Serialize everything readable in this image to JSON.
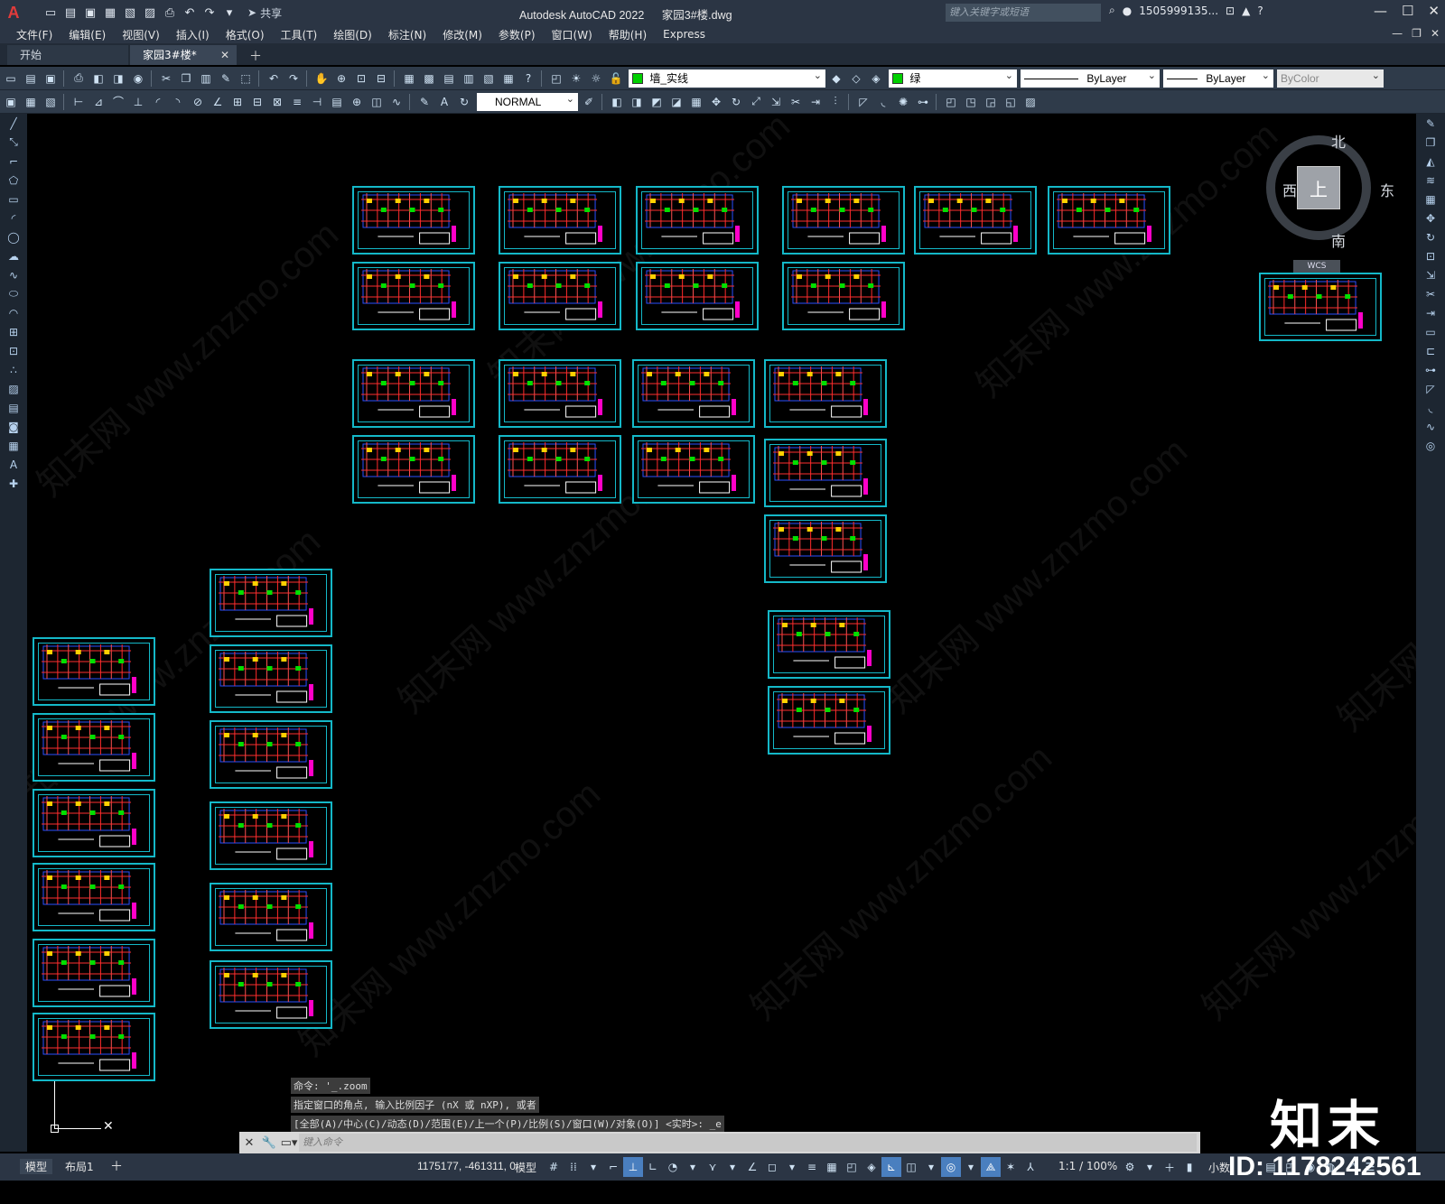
{
  "titlebar": {
    "logo": "A",
    "share_label": "共享",
    "app_name": "Autodesk AutoCAD 2022",
    "file_name": "家园3#楼.dwg",
    "search_placeholder": "键入关键字或短语",
    "user": "1505999135...",
    "help": "?"
  },
  "menu": [
    "文件(F)",
    "编辑(E)",
    "视图(V)",
    "插入(I)",
    "格式(O)",
    "工具(T)",
    "绘图(D)",
    "标注(N)",
    "修改(M)",
    "参数(P)",
    "窗口(W)",
    "帮助(H)",
    "Express"
  ],
  "tabs": {
    "start": "开始",
    "active": "家园3#楼*"
  },
  "toolbar": {
    "layer_name": "墙_实线",
    "color_name": "绿",
    "linetype": "ByLayer",
    "lineweight": "ByLayer",
    "plotstyle": "ByColor",
    "dimstyle": "NORMAL",
    "colors": {
      "accent": "#14b8c8",
      "layer_swatch": "#00d000"
    }
  },
  "compass": {
    "north": "北",
    "south": "南",
    "east": "东",
    "west": "西",
    "top": "上",
    "wcs": "WCS"
  },
  "command": {
    "history": [
      "命令: '_.zoom",
      "指定窗口的角点, 输入比例因子 (nX 或 nXP), 或者",
      "[全部(A)/中心(C)/动态(D)/范围(E)/上一个(P)/比例(S)/窗口(W)/对象(O)] <实时>: _e"
    ],
    "placeholder": "键入命令"
  },
  "status": {
    "model_tab": "模型",
    "layout_tab": "布局1",
    "coords": "1175177, -461311, 0",
    "model": "模型",
    "scale": "1:1 / 100%",
    "units": "小数"
  },
  "brand": {
    "logo": "知末",
    "id": "ID: 1178242561"
  },
  "watermark_text": "知末网 www.znzmo.com"
}
